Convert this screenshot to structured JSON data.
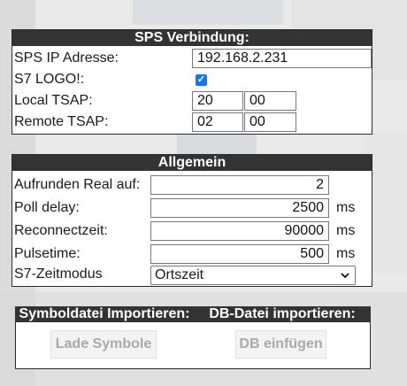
{
  "sps": {
    "title": "SPS Verbindung:",
    "ip_label": "SPS IP Adresse:",
    "ip_value": "192.168.2.231",
    "logo_label": "S7 LOGO!:",
    "logo_checked": true,
    "local_tsap_label": "Local TSAP:",
    "local_tsap_1": "20",
    "local_tsap_2": "00",
    "remote_tsap_label": "Remote TSAP:",
    "remote_tsap_1": "02",
    "remote_tsap_2": "00"
  },
  "allgemein": {
    "title": "Allgemein",
    "round_label": "Aufrunden Real auf:",
    "round_value": "2",
    "poll_label": "Poll delay:",
    "poll_value": "2500",
    "poll_unit": "ms",
    "reconnect_label": "Reconnectzeit:",
    "reconnect_value": "90000",
    "reconnect_unit": "ms",
    "pulse_label": "Pulsetime:",
    "pulse_value": "500",
    "pulse_unit": "ms",
    "zeitmodus_label": "S7-Zeitmodus",
    "zeitmodus_value": "Ortszeit"
  },
  "import": {
    "symbol_title": "Symboldatei Importieren:",
    "db_title": "DB-Datei importieren:",
    "symbol_button": "Lade Symbole",
    "db_button": "DB einfügen"
  },
  "colors": {
    "header_bg": "#333333",
    "checkbox": "#1a73e8"
  }
}
